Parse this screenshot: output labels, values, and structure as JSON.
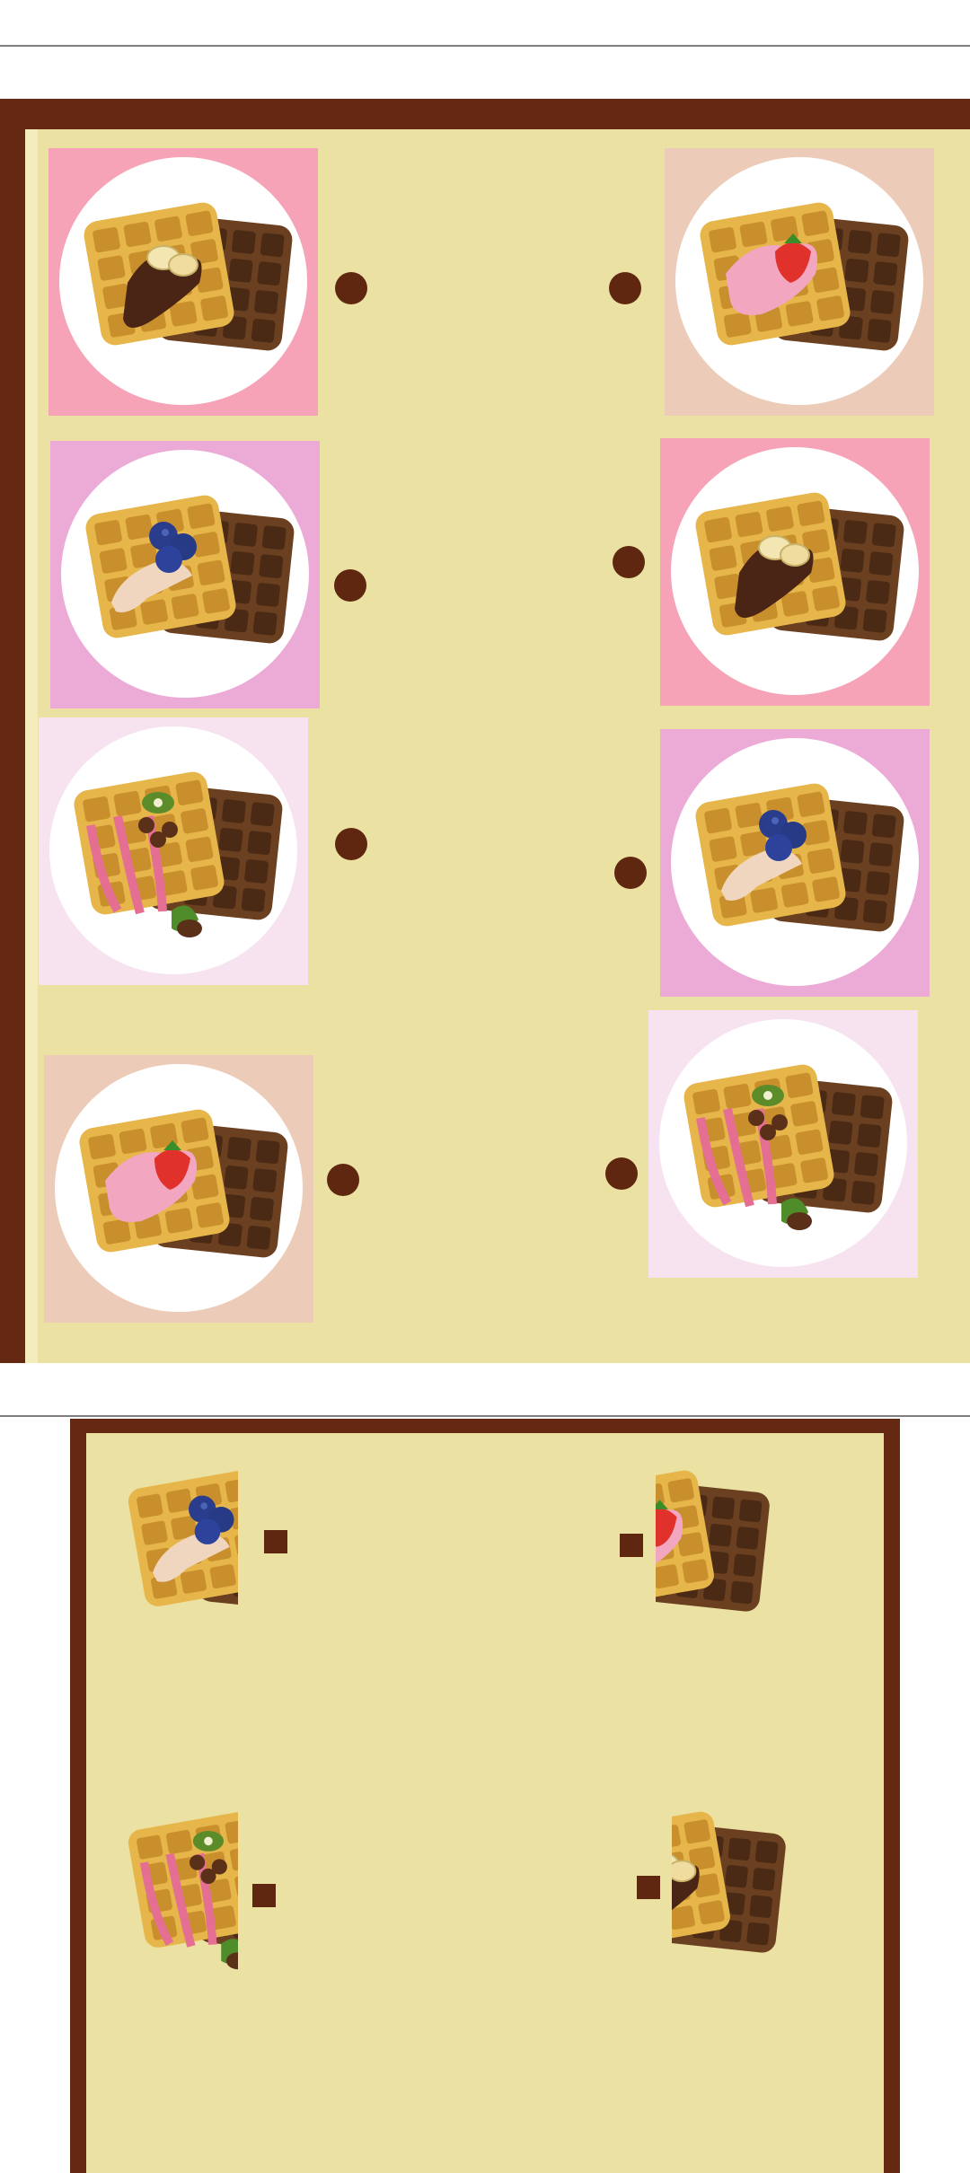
{
  "colors": {
    "board_border": "#652812",
    "board_fill": "#ebe1a3",
    "connector": "#5f2710",
    "pink": "#f6a3b7",
    "peach": "#ecccb8",
    "lilac": "#ecaad6",
    "pale_pink": "#f6e3ef"
  },
  "puzzle_matching_cards": {
    "left_column": [
      {
        "card_color": "pink",
        "topping": "banana-chocolate-icon"
      },
      {
        "card_color": "lilac",
        "topping": "blueberry-cream-icon"
      },
      {
        "card_color": "pale_pink",
        "topping": "kiwi-hazelnut-icon"
      },
      {
        "card_color": "peach",
        "topping": "strawberry-cream-icon"
      }
    ],
    "right_column": [
      {
        "card_color": "peach",
        "topping": "strawberry-cream-icon"
      },
      {
        "card_color": "pink",
        "topping": "banana-chocolate-icon"
      },
      {
        "card_color": "lilac",
        "topping": "blueberry-cream-icon"
      },
      {
        "card_color": "pale_pink",
        "topping": "kiwi-hazelnut-icon"
      }
    ]
  },
  "puzzle_matching_halves": {
    "left_halves": [
      "blueberry-cream-icon",
      "kiwi-hazelnut-icon"
    ],
    "right_halves": [
      "strawberry-cream-icon",
      "banana-chocolate-icon"
    ]
  }
}
